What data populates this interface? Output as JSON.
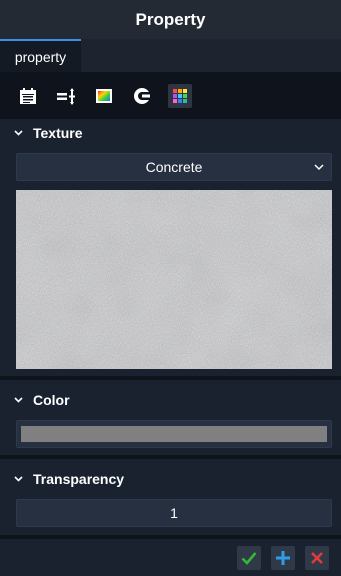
{
  "window": {
    "title": "Property"
  },
  "tabs": [
    {
      "label": "property",
      "active": true
    }
  ],
  "toolbar": {
    "tools": [
      {
        "icon": "calendar-icon",
        "active": false
      },
      {
        "icon": "split-icon",
        "active": false
      },
      {
        "icon": "color-image-icon",
        "active": false
      },
      {
        "icon": "contrast-icon",
        "active": false
      },
      {
        "icon": "palette-grid-icon",
        "active": true
      }
    ]
  },
  "sections": {
    "texture": {
      "label": "Texture",
      "selected": "Concrete",
      "preview": "concrete texture"
    },
    "color": {
      "label": "Color",
      "value": "#808080"
    },
    "transparency": {
      "label": "Transparency",
      "value": "1"
    }
  },
  "actions": {
    "confirm": {
      "icon": "check-icon",
      "color": "#35b835"
    },
    "add": {
      "icon": "plus-icon",
      "color": "#2f9ee8"
    },
    "cancel": {
      "icon": "close-icon",
      "color": "#e23b3b"
    }
  },
  "colors": {
    "accent": "#3a8ee6",
    "panel": "#1a2230",
    "field": "#263041"
  }
}
